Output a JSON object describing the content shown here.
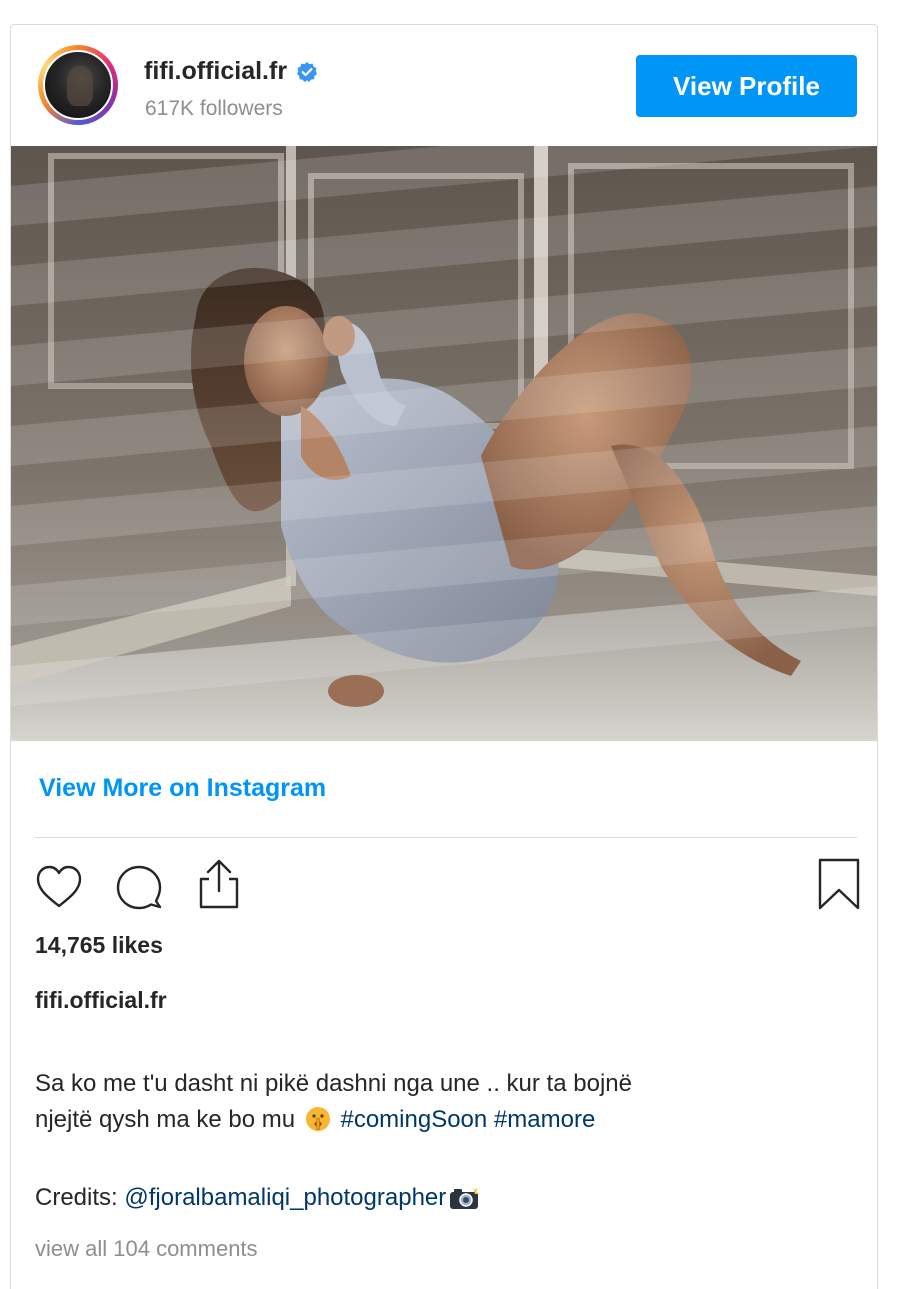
{
  "header": {
    "username": "fifi.official.fr",
    "followers": "617K followers",
    "view_profile_label": "View Profile"
  },
  "post": {
    "view_more_label": "View More on Instagram",
    "likes": "14,765 likes",
    "caption_user": "fifi.official.fr",
    "caption_line1": "Sa ko me t'u dasht ni pikë dashni nga une .. kur ta bojnë",
    "caption_line2": "njejtë qysh ma ke bo mu",
    "hashtag1": "#comingSoon",
    "hashtag2": "#mamore",
    "credits_label": "Credits:",
    "credits_mention": "@fjoralbamaliqi_photographer",
    "comments_link": "view all 104 comments"
  },
  "icons": {
    "verified": "verified-badge-icon",
    "like": "heart-icon",
    "comment": "comment-icon",
    "share": "share-icon",
    "save": "bookmark-icon",
    "emoji_caption": "shushing-face-emoji",
    "emoji_credits": "camera-flash-emoji"
  },
  "colors": {
    "accent": "#0095f6",
    "hashtag": "#00376b",
    "muted": "#8e8e8e",
    "text": "#262626",
    "border": "#dbdbdb"
  }
}
